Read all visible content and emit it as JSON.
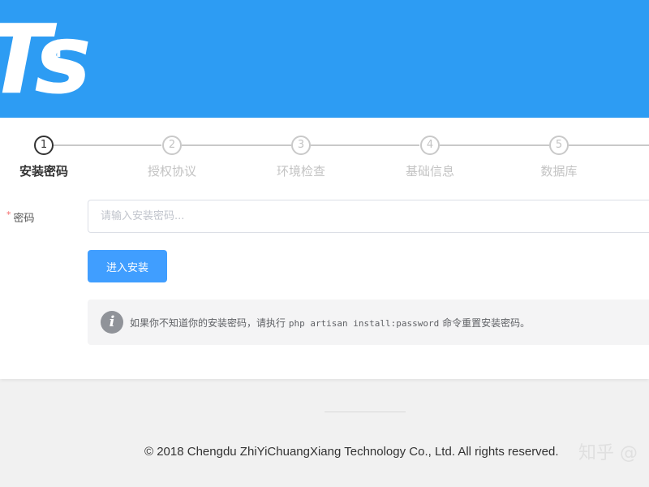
{
  "header": {
    "logo_text": "Ts",
    "logo_plus": "+",
    "accent_color": "#2d9cf3"
  },
  "steps": [
    {
      "number": "1",
      "label": "安装密码",
      "active": true
    },
    {
      "number": "2",
      "label": "授权协议",
      "active": false
    },
    {
      "number": "3",
      "label": "环境检查",
      "active": false
    },
    {
      "number": "4",
      "label": "基础信息",
      "active": false
    },
    {
      "number": "5",
      "label": "数据库",
      "active": false
    }
  ],
  "form": {
    "required_mark": "*",
    "password_label": "密码",
    "password_placeholder": "请输入安装密码...",
    "password_value": "",
    "submit_label": "进入安装"
  },
  "alert": {
    "icon": "info-icon",
    "text_before": "如果你不知道你的安装密码，请执行 ",
    "command": "php artisan install:password",
    "text_after": " 命令重置安装密码。"
  },
  "footer": {
    "copyright": "© 2018 Chengdu ZhiYiChuangXiang Technology Co., Ltd. All rights reserved."
  },
  "watermark": "知乎 @"
}
